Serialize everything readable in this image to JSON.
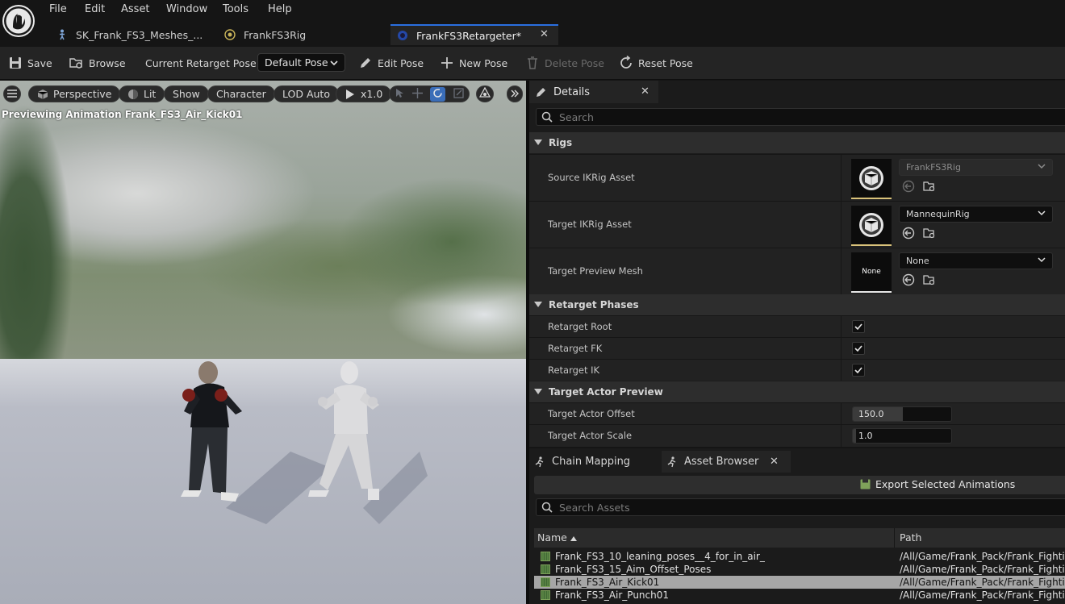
{
  "menu": [
    "File",
    "Edit",
    "Asset",
    "Window",
    "Tools",
    "Help"
  ],
  "doc_tabs": [
    {
      "label": "SK_Frank_FS3_Meshes_..."
    },
    {
      "label": "FrankFS3Rig"
    },
    {
      "label": "FrankFS3Retargeter*"
    }
  ],
  "toolbar": {
    "save": "Save",
    "browse": "Browse",
    "current_pose_label": "Current Retarget Pose:",
    "current_pose_value": "Default Pose",
    "edit_pose": "Edit Pose",
    "new_pose": "New Pose",
    "delete_pose": "Delete Pose",
    "reset_pose": "Reset Pose"
  },
  "viewport": {
    "perspective": "Perspective",
    "lit": "Lit",
    "show": "Show",
    "character": "Character",
    "lod": "LOD Auto",
    "speed": "x1.0",
    "caption": "Previewing Animation Frank_FS3_Air_Kick01"
  },
  "details": {
    "tab": "Details",
    "search_placeholder": "Search",
    "sections": {
      "rigs": "Rigs",
      "phases": "Retarget Phases",
      "preview": "Target Actor Preview"
    },
    "rows": {
      "source_label": "Source IKRig Asset",
      "source_value": "FrankFS3Rig",
      "target_label": "Target IKRig Asset",
      "target_value": "MannequinRig",
      "mesh_label": "Target Preview Mesh",
      "mesh_value": "None",
      "mesh_thumb": "None",
      "root_label": "Retarget Root",
      "fk_label": "Retarget FK",
      "ik_label": "Retarget IK",
      "offset_label": "Target Actor Offset",
      "offset_value": "150.0",
      "scale_label": "Target Actor Scale",
      "scale_value": "1.0"
    },
    "checks": {
      "root": true,
      "fk": true,
      "ik": true
    }
  },
  "bottom": {
    "tab_chain": "Chain Mapping",
    "tab_assets": "Asset Browser",
    "export": "Export Selected Animations",
    "search_placeholder": "Search Assets",
    "col_name": "Name",
    "col_path": "Path",
    "rows": [
      {
        "name": "Frank_FS3_10_leaning_poses__4_for_in_air_",
        "path": "/All/Game/Frank_Pack/Frank_Fighti"
      },
      {
        "name": "Frank_FS3_15_Aim_Offset_Poses",
        "path": "/All/Game/Frank_Pack/Frank_Fighti"
      },
      {
        "name": "Frank_FS3_Air_Kick01",
        "path": "/All/Game/Frank_Pack/Frank_Fighti"
      },
      {
        "name": "Frank_FS3_Air_Punch01",
        "path": "/All/Game/Frank_Pack/Frank_Fighti"
      }
    ]
  },
  "colors": {
    "accent": "#2a6fe0",
    "thumb_underline": "#d9c27a",
    "selected_row": "#a6a6a6"
  }
}
